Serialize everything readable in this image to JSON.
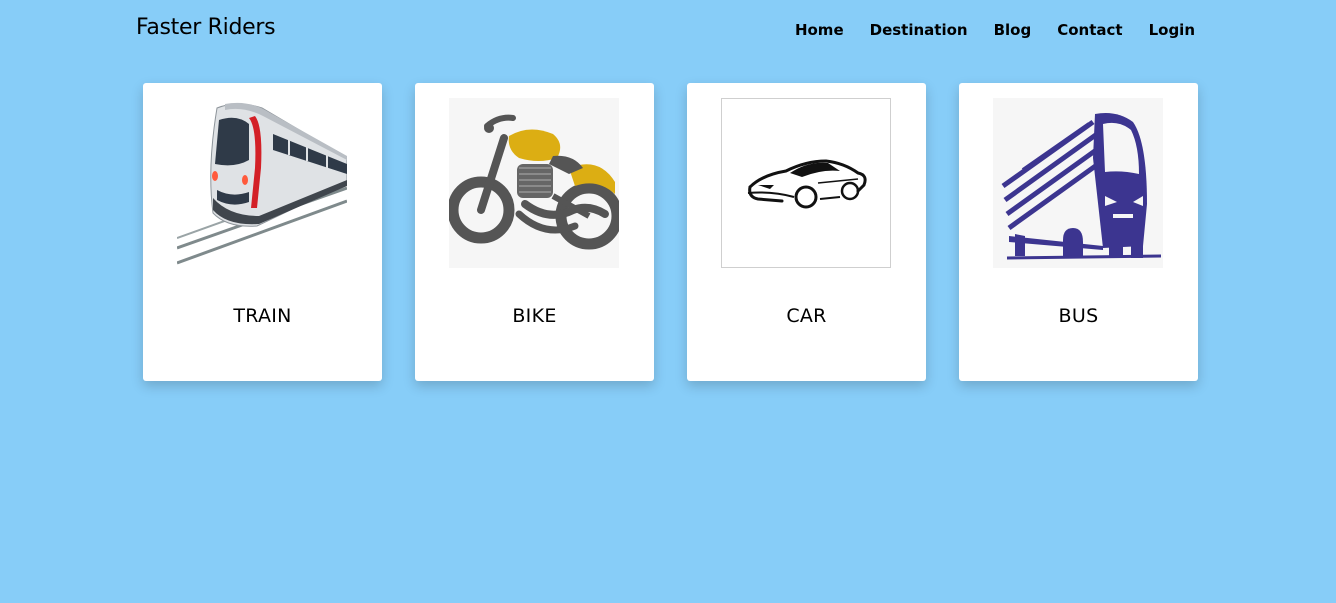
{
  "brand": "Faster Riders",
  "nav": {
    "items": [
      "Home",
      "Destination",
      "Blog",
      "Contact",
      "Login"
    ]
  },
  "cards": [
    {
      "label": "TRAIN",
      "image": "train-icon"
    },
    {
      "label": "BIKE",
      "image": "motorcycle-icon"
    },
    {
      "label": "CAR",
      "image": "sports-car-icon"
    },
    {
      "label": "BUS",
      "image": "bus-icon"
    }
  ],
  "colors": {
    "background": "#87cdf8",
    "card": "#ffffff",
    "bike_accent": "#dcae13",
    "bus_accent": "#3c3590",
    "train_accent": "#d32027"
  }
}
